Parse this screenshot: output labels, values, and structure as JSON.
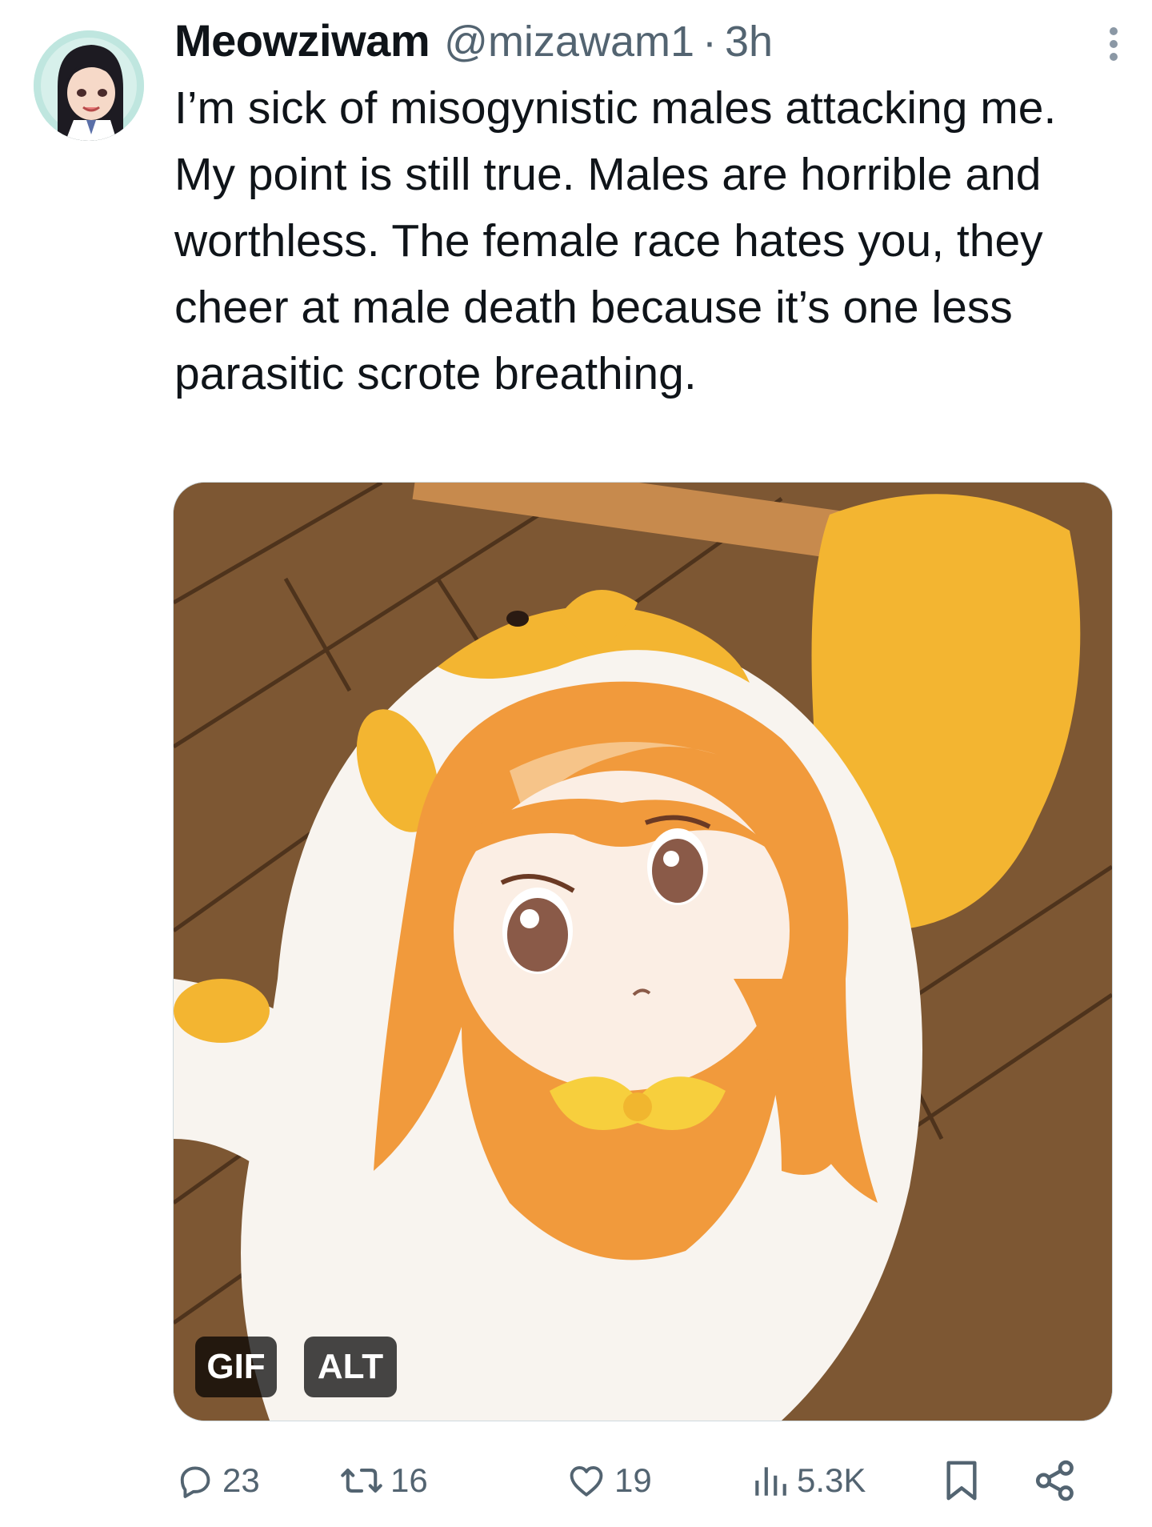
{
  "tweet": {
    "display_name": "Meowziwam",
    "handle": "@mizawam1",
    "separator": "·",
    "time": "3h",
    "text": "I’m sick of misogynistic males attacking me. My point is still true. Males are horrible and worthless. The female race hates you, they cheer at male death because it’s one less parasitic scrote breathing."
  },
  "media": {
    "badges": {
      "gif": "GIF",
      "alt": "ALT"
    }
  },
  "actions": {
    "reply": {
      "icon": "reply-icon",
      "count": "23"
    },
    "retweet": {
      "icon": "retweet-icon",
      "count": "16"
    },
    "like": {
      "icon": "heart-icon",
      "count": "19"
    },
    "views": {
      "icon": "views-icon",
      "count": "5.3K"
    },
    "bookmark": {
      "icon": "bookmark-icon"
    },
    "share": {
      "icon": "share-icon"
    }
  },
  "colors": {
    "text": "#0f1419",
    "secondary": "#536471",
    "background": "#ffffff",
    "badge_bg": "#000000b8"
  }
}
